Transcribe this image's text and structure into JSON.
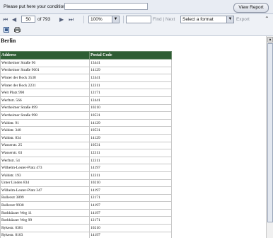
{
  "condition": {
    "label": "Please put here your condition!",
    "value": "",
    "button": "View Report"
  },
  "toolbar": {
    "first_icon": "⏮",
    "prev_icon": "◀",
    "next_icon": "▶",
    "last_icon": "⏭",
    "page": "50",
    "page_count": "of 793",
    "zoom": "100%",
    "find_label": "Find",
    "find_sep": "|",
    "next_label": "Next",
    "format": "Select a format",
    "export_label": "Export",
    "collapse_icon": "⌃"
  },
  "report": {
    "title": "Berlin",
    "columns": [
      "Address",
      "Postal Code"
    ],
    "rows": [
      [
        "Wertheimer Straße 96",
        "13441"
      ],
      [
        "Wertheimer Straße 9601",
        "14129"
      ],
      [
        "Winter der Bock 3538",
        "12441"
      ],
      [
        "Winter der Bock 2231",
        "12311"
      ],
      [
        "Welt Platz 990",
        "12171"
      ],
      [
        "Werftstr. 566",
        "12441"
      ],
      [
        "Wertheimer Straße 899",
        "10210"
      ],
      [
        "Wertheimer Straße 998",
        "10531"
      ],
      [
        "Waldstr. 91",
        "14129"
      ],
      [
        "Waldstr. 340",
        "10531"
      ],
      [
        "Waldstr. 834",
        "14129"
      ],
      [
        "Wasserstr. 25",
        "10531"
      ],
      [
        "Wasserstr. 63",
        "12311"
      ],
      [
        "Werftstr. 54",
        "12311"
      ],
      [
        "Wilhelm-Leuter-Platz 473",
        "14197"
      ],
      [
        "Waldstr. 193",
        "12311"
      ],
      [
        "Unter Linden 834",
        "10210"
      ],
      [
        "Wilhelm-Leuter-Platz 347",
        "14197"
      ],
      [
        "Rollerstr 3899",
        "12171"
      ],
      [
        "Rollerstr 9938",
        "14197"
      ],
      [
        "Rothhäuser Weg 11",
        "14197"
      ],
      [
        "Rothhäuser Weg 99",
        "12171"
      ],
      [
        "Rykestr. 0381",
        "10210"
      ],
      [
        "Rykestr. 8103",
        "14197"
      ],
      [
        "Rosen Straße 2155",
        "12171"
      ]
    ]
  }
}
